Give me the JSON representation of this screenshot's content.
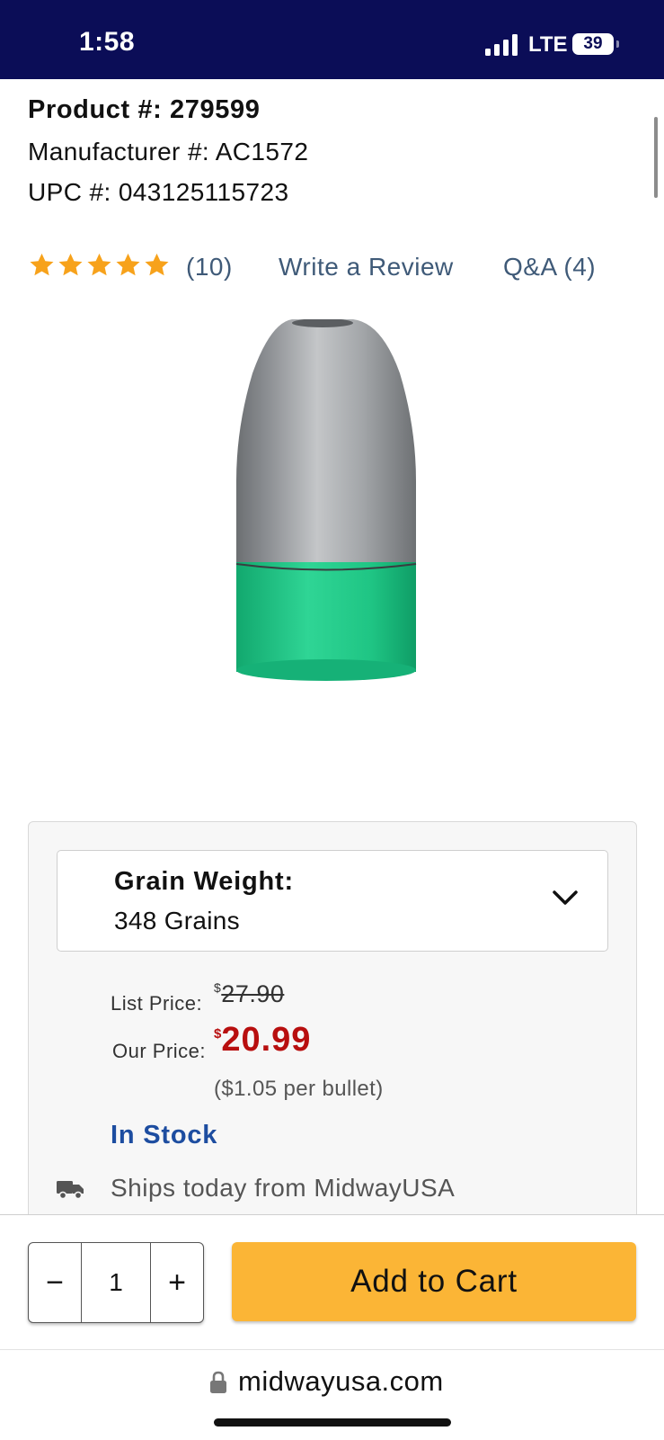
{
  "status_bar": {
    "time": "1:58",
    "network": "LTE",
    "battery": "39"
  },
  "product": {
    "product_number": "Product #: 279599",
    "manufacturer_number": "Manufacturer #: AC1572",
    "upc": "UPC #: 043125115723",
    "rating": {
      "stars": 5,
      "max_stars": 5,
      "color": "#f7a21b"
    },
    "review_count": "(10)",
    "write_review_label": "Write a Review",
    "qa_label": "Q&A (4)",
    "image_icon": "bullet-product-image"
  },
  "options": {
    "grain_weight_label": "Grain Weight:",
    "grain_weight_value": "348 Grains",
    "chevron_icon": "chevron-down-icon"
  },
  "pricing": {
    "list_label": "List Price:",
    "list_currency": "$",
    "list_amount": "27.90",
    "our_label": "Our Price:",
    "our_currency": "$",
    "our_amount": "20.99",
    "per_unit": "($1.05 per bullet)",
    "price_color": "#b80f0f"
  },
  "availability": {
    "stock_status": "In Stock",
    "shipping_text": "Ships today from MidwayUSA",
    "truck_icon": "truck-icon"
  },
  "purchase": {
    "minus_label": "−",
    "quantity": "1",
    "plus_label": "+",
    "add_to_cart_label": "Add to Cart",
    "button_color": "#fbb536"
  },
  "browser": {
    "url": "midwayusa.com",
    "lock_icon": "lock-icon"
  }
}
